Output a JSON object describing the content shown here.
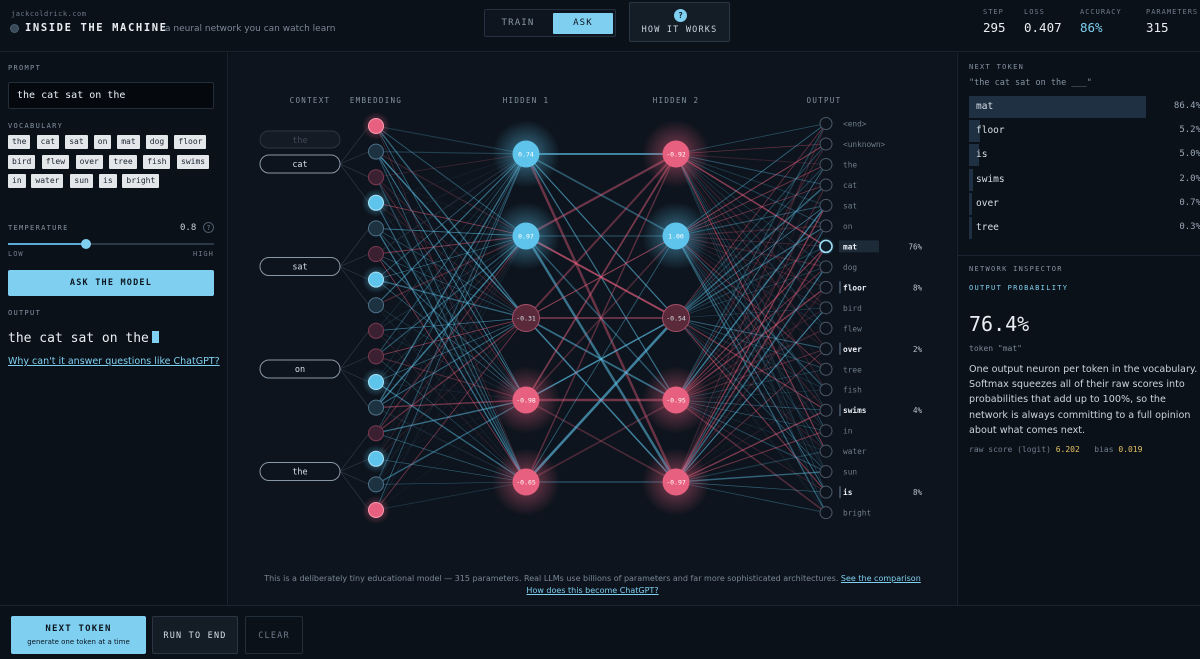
{
  "header": {
    "site": "jackcoldrick.com",
    "title": "INSIDE THE MACHINE",
    "tagline": "a neural network you can watch learn",
    "modes": [
      "TRAIN",
      "ASK"
    ],
    "active_mode": "ASK",
    "how_icon": "?",
    "how_label": "HOW IT WORKS",
    "stats": [
      {
        "label": "STEP",
        "value": "295"
      },
      {
        "label": "LOSS",
        "value": "0.407"
      },
      {
        "label": "ACCURACY",
        "value": "86%"
      },
      {
        "label": "PARAMETERS",
        "value": "315"
      }
    ]
  },
  "left": {
    "prompt_label": "PROMPT",
    "prompt_value": "the cat sat on the",
    "vocab_label": "VOCABULARY",
    "vocab": [
      "the",
      "cat",
      "sat",
      "on",
      "mat",
      "dog",
      "floor",
      "bird",
      "flew",
      "over",
      "tree",
      "fish",
      "swims",
      "in",
      "water",
      "sun",
      "is",
      "bright"
    ],
    "temp_label": "TEMPERATURE",
    "temp_value": "0.8",
    "temp_fraction": 0.38,
    "temp_help": "?",
    "temp_low": "LOW",
    "temp_high": "HIGH",
    "ask_button": "ASK THE MODEL",
    "output_label": "OUTPUT",
    "output_text": "the cat sat on the",
    "why_link": "Why can't it answer questions like ChatGPT?"
  },
  "network": {
    "layer_labels": [
      "CONTEXT",
      "EMBEDDING",
      "HIDDEN 1",
      "HIDDEN 2",
      "OUTPUT"
    ],
    "context_tokens": [
      "the",
      "cat",
      "sat",
      "on",
      "the"
    ],
    "hidden1": [
      "0.74",
      "0.97",
      "-0.31",
      "-0.98",
      "-0.65"
    ],
    "hidden2": [
      "-0.92",
      "1.00",
      "-0.54",
      "-0.95",
      "-0.97"
    ],
    "output_tokens": [
      "<end>",
      "<unknown>",
      "the",
      "cat",
      "sat",
      "on",
      "mat",
      "dog",
      "floor",
      "bird",
      "flew",
      "over",
      "tree",
      "fish",
      "swims",
      "in",
      "water",
      "sun",
      "is",
      "bright"
    ],
    "output_pcts": {
      "mat": "76%",
      "floor": "8%",
      "over": "2%",
      "swims": "4%",
      "is": "8%"
    },
    "colors": {
      "positive": "#5fc4ec",
      "negative": "#e8607f",
      "dim": "#2a3a4c"
    },
    "footnote": "This is a deliberately tiny educational model — 315 parameters. Real LLMs use billions of parameters and far more sophisticated architectures.",
    "footnote_link": "See the comparison",
    "footnote_link2": "How does this become ChatGPT?"
  },
  "right": {
    "next_token_label": "NEXT TOKEN",
    "next_token_sub": "\"the cat sat on the ___\"",
    "predictions": [
      {
        "token": "mat",
        "pct": "86.4%",
        "fraction": 0.864
      },
      {
        "token": "floor",
        "pct": "5.2%",
        "fraction": 0.052
      },
      {
        "token": "is",
        "pct": "5.0%",
        "fraction": 0.05
      },
      {
        "token": "swims",
        "pct": "2.0%",
        "fraction": 0.02
      },
      {
        "token": "over",
        "pct": "0.7%",
        "fraction": 0.007
      },
      {
        "token": "tree",
        "pct": "0.3%",
        "fraction": 0.003
      }
    ],
    "inspector_label": "NETWORK INSPECTOR",
    "inspector_sub": "OUTPUT PROBABILITY",
    "inspector_value": "76.4%",
    "inspector_token": "token \"mat\"",
    "inspector_desc": "One output neuron per token in the vocabulary. Softmax squeezes all of their raw scores into probabilities that add up to 100%, so the network is always committing to a full opinion about what comes next.",
    "raw_label": "raw score (logit)",
    "raw_value": "6.202",
    "bias_label": "bias",
    "bias_value": "0.019"
  },
  "bottom": {
    "next_button": "NEXT TOKEN",
    "next_sub": "generate one token at a time",
    "run_button": "RUN TO END",
    "clear_button": "CLEAR"
  }
}
